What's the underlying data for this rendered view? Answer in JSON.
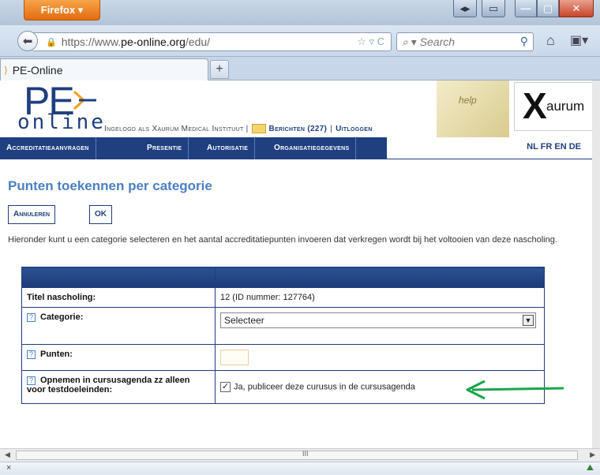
{
  "browser": {
    "app_button": "Firefox ▾",
    "url_prefix": "https://www.",
    "url_domain": "pe-online.org",
    "url_path": "/edu/",
    "search_placeholder": "Search",
    "tab_title": "PE-Online",
    "new_tab": "+"
  },
  "site": {
    "logo_top": "PE",
    "logo_bottom": "online",
    "login_text": "Ingelogd als Xaurum Medical Instituut |",
    "messages_link": "Berichten (227)",
    "separator": "|",
    "logout_link": "Uitloggen",
    "help_text": "help",
    "partner_logo": "aurum",
    "menu": [
      "Accreditatieaanvragen",
      "Presentie",
      "Autorisatie",
      "Organisatiegegevens"
    ],
    "languages": "NL FR EN DE"
  },
  "page": {
    "title": "Punten toekennen per categorie",
    "cancel_button": "Annuleren",
    "ok_button": "OK",
    "intro": "Hieronder kunt u een categorie selecteren en het aantal accreditatiepunten invoeren dat verkregen wordt bij het voltooien van deze nascholing."
  },
  "form": {
    "title_label": "Titel nascholing:",
    "title_value": "12 (ID nummer: 127764)",
    "category_label": "Categorie:",
    "category_selected": "Selecteer",
    "points_label": "Punten:",
    "points_value": "",
    "agenda_label": "Opnemen in cursusagenda zz alleen voor testdoeleinden:",
    "agenda_checkbox_label": "Ja, publiceer deze curusus in de cursusagenda",
    "agenda_checked": true
  },
  "colors": {
    "brand_blue": "#1f3f80",
    "title_blue": "#4a7fc5",
    "annotation_arrow": "#1aa64a"
  },
  "statusbar": {
    "close": "×",
    "scroll_grip": "III"
  }
}
